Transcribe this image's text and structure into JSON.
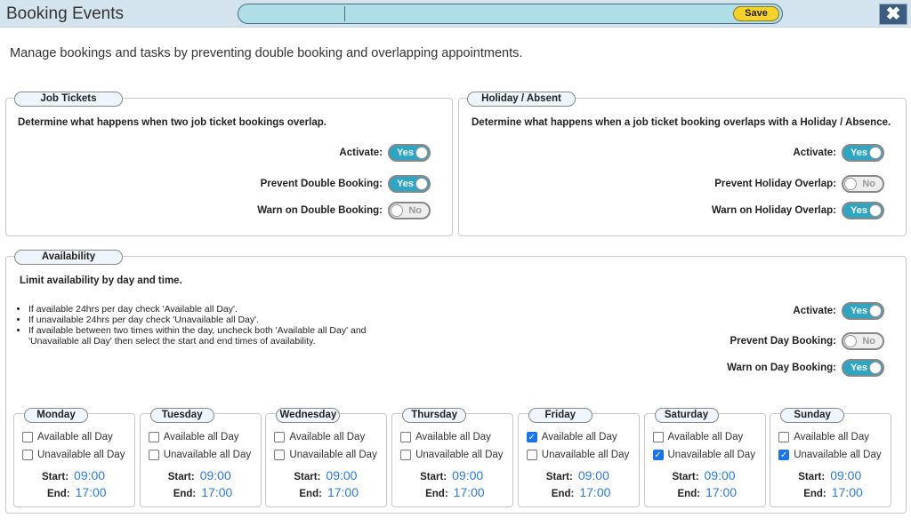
{
  "header": {
    "title": "Booking Events",
    "search_value": "",
    "save_label": "Save",
    "close_label": "✖"
  },
  "description": "Manage bookings and tasks by preventing double booking and overlapping appointments.",
  "job_tickets": {
    "legend": "Job Tickets",
    "text": "Determine what happens when two job ticket bookings overlap.",
    "rows": [
      {
        "label": "Activate:",
        "value": "Yes",
        "on": true
      },
      {
        "label": "Prevent Double Booking:",
        "value": "Yes",
        "on": true
      },
      {
        "label": "Warn on Double Booking:",
        "value": "No",
        "on": false
      }
    ]
  },
  "holiday": {
    "legend": "Holiday / Absent",
    "text": "Determine what happens when a job ticket booking overlaps with a Holiday / Absence.",
    "rows": [
      {
        "label": "Activate:",
        "value": "Yes",
        "on": true
      },
      {
        "label": "Prevent Holiday Overlap:",
        "value": "No",
        "on": false
      },
      {
        "label": "Warn on Holiday Overlap:",
        "value": "Yes",
        "on": true
      }
    ]
  },
  "availability": {
    "legend": "Availability",
    "text": "Limit availability by day and time.",
    "bullets": [
      "If available 24hrs per day check 'Available all Day'.",
      "If unavailable 24hrs per day check 'Unavailable all Day'.",
      "If available between two times within the day, uncheck both 'Available all Day' and 'Unavailable all Day' then select the start and end times of availability."
    ],
    "rows": [
      {
        "label": "Activate:",
        "value": "Yes",
        "on": true
      },
      {
        "label": "Prevent Day Booking:",
        "value": "No",
        "on": false
      },
      {
        "label": "Warn on Day Booking:",
        "value": "Yes",
        "on": true
      }
    ],
    "available_label": "Available all Day",
    "unavailable_label": "Unavailable all Day",
    "start_label": "Start:",
    "end_label": "End:",
    "days": [
      {
        "name": "Monday",
        "available": false,
        "unavailable": false,
        "start": "09:00",
        "end": "17:00"
      },
      {
        "name": "Tuesday",
        "available": false,
        "unavailable": false,
        "start": "09:00",
        "end": "17:00"
      },
      {
        "name": "Wednesday",
        "available": false,
        "unavailable": false,
        "start": "09:00",
        "end": "17:00"
      },
      {
        "name": "Thursday",
        "available": false,
        "unavailable": false,
        "start": "09:00",
        "end": "17:00"
      },
      {
        "name": "Friday",
        "available": true,
        "unavailable": false,
        "start": "09:00",
        "end": "17:00"
      },
      {
        "name": "Saturday",
        "available": false,
        "unavailable": true,
        "start": "09:00",
        "end": "17:00"
      },
      {
        "name": "Sunday",
        "available": false,
        "unavailable": true,
        "start": "09:00",
        "end": "17:00"
      }
    ]
  }
}
